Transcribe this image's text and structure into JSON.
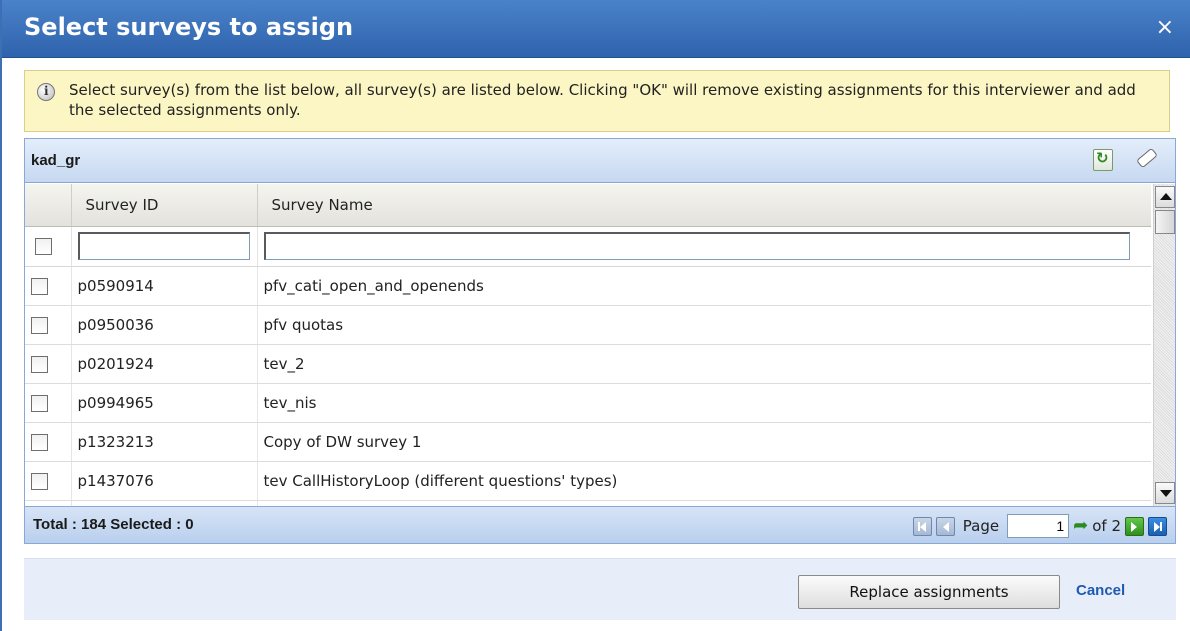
{
  "dialog": {
    "title": "Select surveys to assign",
    "close_glyph": "×"
  },
  "info": {
    "icon": "info-icon",
    "text": "Select survey(s) from the list below, all survey(s) are listed below. Clicking \"OK\" will remove existing assignments for this interviewer and add the selected assignments only."
  },
  "grid": {
    "name": "kad_gr",
    "toolbar_icons": [
      "refresh-icon",
      "eraser-icon"
    ],
    "columns": [
      "Survey ID",
      "Survey Name"
    ],
    "filters": {
      "survey_id": "",
      "survey_name": ""
    },
    "rows": [
      {
        "id": "p0590914",
        "name": "pfv_cati_open_and_openends"
      },
      {
        "id": "p0950036",
        "name": "pfv quotas"
      },
      {
        "id": "p0201924",
        "name": "tev_2"
      },
      {
        "id": "p0994965",
        "name": "tev_nis"
      },
      {
        "id": "p1323213",
        "name": "Copy of DW survey 1"
      },
      {
        "id": "p1437076",
        "name": "tev CallHistoryLoop (different questions' types)"
      }
    ]
  },
  "footer_bar": {
    "total": "Total : 184 Selected : 0",
    "page_label": "Page",
    "page_value": "1",
    "of_label": "of 2"
  },
  "actions": {
    "replace_label": "Replace assignments",
    "cancel_label": "Cancel"
  },
  "colors": {
    "title_bar": "#3a70ba",
    "info_bg": "#fbf6c4",
    "grid_border": "#8aa8d4",
    "cancel_link": "#1d5ab0"
  }
}
